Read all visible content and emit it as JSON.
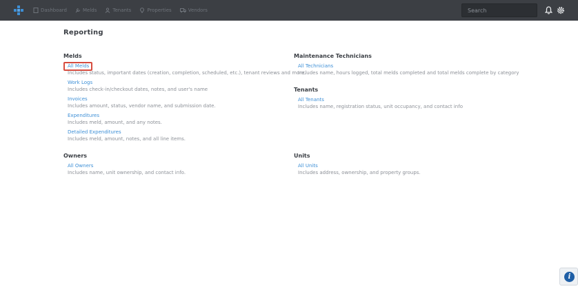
{
  "nav": {
    "items": [
      {
        "label": "Dashboard",
        "icon": "dashboard-icon"
      },
      {
        "label": "Melds",
        "icon": "wrench-icon"
      },
      {
        "label": "Tenants",
        "icon": "person-icon"
      },
      {
        "label": "Properties",
        "icon": "location-pin-icon"
      },
      {
        "label": "Vendors",
        "icon": "truck-icon"
      }
    ]
  },
  "search": {
    "placeholder": "Search"
  },
  "page": {
    "title": "Reporting"
  },
  "sections": {
    "melds": {
      "title": "Melds",
      "reports": [
        {
          "link": "All Melds",
          "desc": "Includes status, important dates (creation, completion, scheduled, etc.), tenant reviews and more."
        },
        {
          "link": "Work Logs",
          "desc": "Includes check-in/checkout dates, notes, and user's name"
        },
        {
          "link": "Invoices",
          "desc": "Includes amount, status, vendor name, and submission date."
        },
        {
          "link": "Expenditures",
          "desc": "Includes meld, amount, and any notes."
        },
        {
          "link": "Detailed Expenditures",
          "desc": "Includes meld, amount, notes, and all line items."
        }
      ]
    },
    "owners": {
      "title": "Owners",
      "reports": [
        {
          "link": "All Owners",
          "desc": "Includes name, unit ownership, and contact info."
        }
      ]
    },
    "technicians": {
      "title": "Maintenance Technicians",
      "reports": [
        {
          "link": "All Technicians",
          "desc": "Includes name, hours logged, total melds completed and total melds complete by category"
        }
      ]
    },
    "tenants": {
      "title": "Tenants",
      "reports": [
        {
          "link": "All Tenants",
          "desc": "Includes name, registration status, unit occupancy, and contact info"
        }
      ]
    },
    "units": {
      "title": "Units",
      "reports": [
        {
          "link": "All Units",
          "desc": "Includes address, ownership, and property groups."
        }
      ]
    }
  },
  "help": {
    "glyph": "i"
  },
  "colors": {
    "topbar": "#3c3f44",
    "link": "#3d8fd6",
    "highlight": "#d64b3e",
    "logo": "#3d8fd6"
  }
}
